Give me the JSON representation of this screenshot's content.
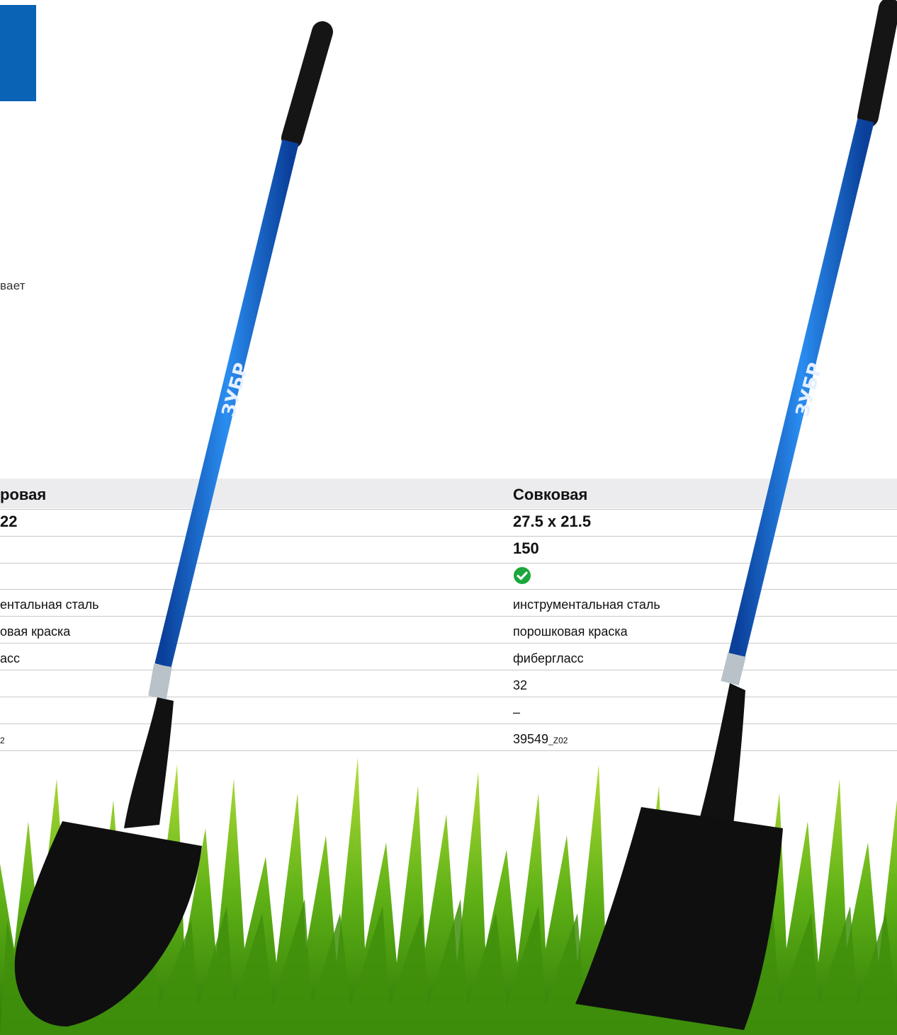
{
  "intro": {
    "fragment": "вает"
  },
  "columns": {
    "left": {
      "type": "ровая",
      "size": "22",
      "material": "ентальная сталь",
      "coating": "овая краска",
      "handle": "асс",
      "code_suffix": "2"
    },
    "right": {
      "type": "Совковая",
      "size": "27.5 x 21.5",
      "length": "150",
      "check": "check-circle-icon",
      "material": "инструментальная сталь",
      "coating": "порошковая краска",
      "handle": "фибергласс",
      "diameter": "32",
      "dash": "–",
      "code": "39549",
      "code_suffix": "_Z02"
    }
  },
  "handle_brand": "ЗУБР",
  "colors": {
    "accent_blue": "#0a63b5",
    "check_green": "#1aa73b",
    "header_gray": "#ececee"
  }
}
